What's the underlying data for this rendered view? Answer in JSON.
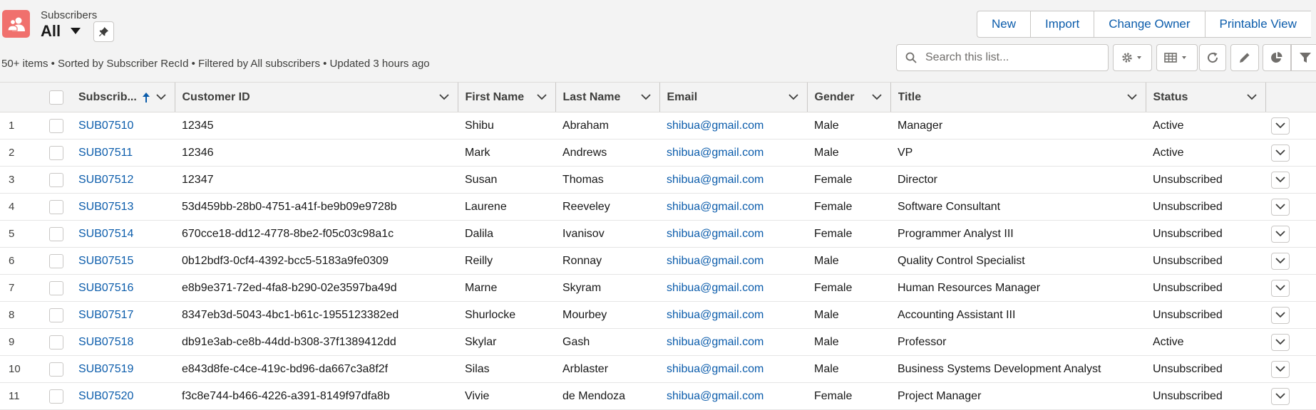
{
  "header": {
    "object_label": "Subscribers",
    "view_name": "All",
    "meta_text": "50+ items • Sorted by Subscriber RecId • Filtered by All subscribers • Updated 3 hours ago"
  },
  "actions": [
    "New",
    "Import",
    "Change Owner",
    "Printable View"
  ],
  "search": {
    "placeholder": "Search this list..."
  },
  "toolbar_icons": [
    "gear-icon",
    "table-view-icon",
    "refresh-icon",
    "edit-icon",
    "pie-chart-icon",
    "filter-icon"
  ],
  "columns": [
    "Subscrib...",
    "Customer ID",
    "First Name",
    "Last Name",
    "Email",
    "Gender",
    "Title",
    "Status"
  ],
  "colors": {
    "link": "#0b5cab",
    "brand_icon": "#f0706d",
    "header_bg": "#f3f3f3"
  },
  "rows": [
    {
      "num": "1",
      "id": "SUB07510",
      "customer_id": "12345",
      "first": "Shibu",
      "last": "Abraham",
      "email": "shibua@gmail.com",
      "gender": "Male",
      "title": "Manager",
      "status": "Active"
    },
    {
      "num": "2",
      "id": "SUB07511",
      "customer_id": "12346",
      "first": "Mark",
      "last": "Andrews",
      "email": "shibua@gmail.com",
      "gender": "Male",
      "title": "VP",
      "status": "Active"
    },
    {
      "num": "3",
      "id": "SUB07512",
      "customer_id": "12347",
      "first": "Susan",
      "last": "Thomas",
      "email": "shibua@gmail.com",
      "gender": "Female",
      "title": "Director",
      "status": "Unsubscribed"
    },
    {
      "num": "4",
      "id": "SUB07513",
      "customer_id": "53d459bb-28b0-4751-a41f-be9b09e9728b",
      "first": "Laurene",
      "last": "Reeveley",
      "email": "shibua@gmail.com",
      "gender": "Female",
      "title": "Software Consultant",
      "status": "Unsubscribed"
    },
    {
      "num": "5",
      "id": "SUB07514",
      "customer_id": "670cce18-dd12-4778-8be2-f05c03c98a1c",
      "first": "Dalila",
      "last": "Ivanisov",
      "email": "shibua@gmail.com",
      "gender": "Female",
      "title": "Programmer Analyst III",
      "status": "Unsubscribed"
    },
    {
      "num": "6",
      "id": "SUB07515",
      "customer_id": "0b12bdf3-0cf4-4392-bcc5-5183a9fe0309",
      "first": "Reilly",
      "last": "Ronnay",
      "email": "shibua@gmail.com",
      "gender": "Male",
      "title": "Quality Control Specialist",
      "status": "Unsubscribed"
    },
    {
      "num": "7",
      "id": "SUB07516",
      "customer_id": "e8b9e371-72ed-4fa8-b290-02e3597ba49d",
      "first": "Marne",
      "last": "Skyram",
      "email": "shibua@gmail.com",
      "gender": "Female",
      "title": "Human Resources Manager",
      "status": "Unsubscribed"
    },
    {
      "num": "8",
      "id": "SUB07517",
      "customer_id": "8347eb3d-5043-4bc1-b61c-1955123382ed",
      "first": "Shurlocke",
      "last": "Mourbey",
      "email": "shibua@gmail.com",
      "gender": "Male",
      "title": "Accounting Assistant III",
      "status": "Unsubscribed"
    },
    {
      "num": "9",
      "id": "SUB07518",
      "customer_id": "db91e3ab-ce8b-44dd-b308-37f1389412dd",
      "first": "Skylar",
      "last": "Gash",
      "email": "shibua@gmail.com",
      "gender": "Male",
      "title": "Professor",
      "status": "Active"
    },
    {
      "num": "10",
      "id": "SUB07519",
      "customer_id": "e843d8fe-c4ce-419c-bd96-da667c3a8f2f",
      "first": "Silas",
      "last": "Arblaster",
      "email": "shibua@gmail.com",
      "gender": "Male",
      "title": "Business Systems Development Analyst",
      "status": "Unsubscribed"
    },
    {
      "num": "11",
      "id": "SUB07520",
      "customer_id": "f3c8e744-b466-4226-a391-8149f97dfa8b",
      "first": "Vivie",
      "last": "de Mendoza",
      "email": "shibua@gmail.com",
      "gender": "Female",
      "title": "Project Manager",
      "status": "Unsubscribed"
    }
  ]
}
